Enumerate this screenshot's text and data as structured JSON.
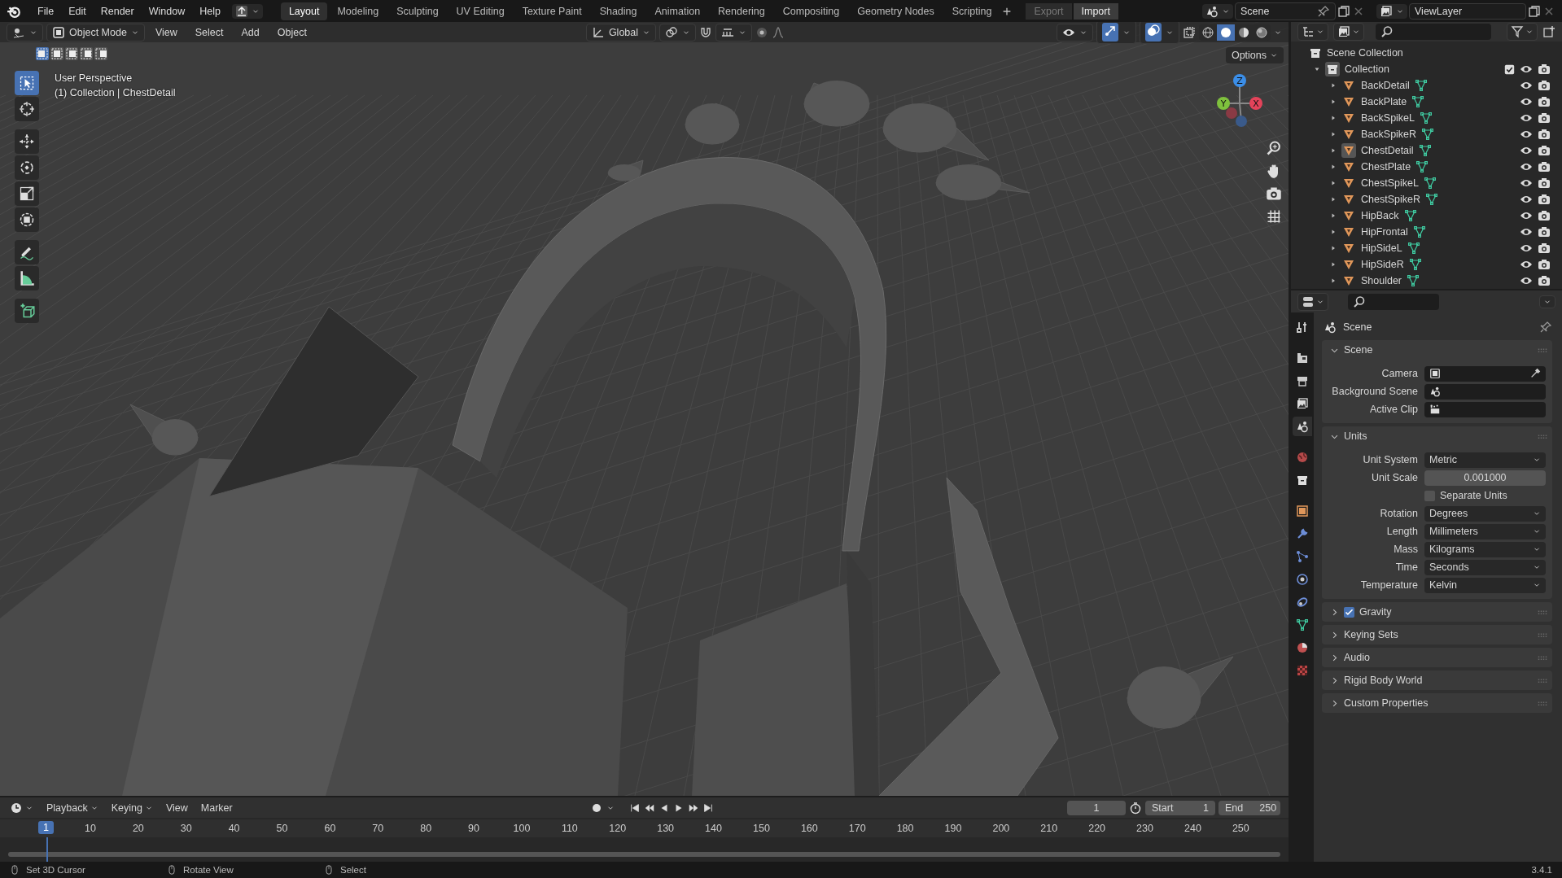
{
  "top_bar": {
    "menus": [
      "File",
      "Edit",
      "Render",
      "Window",
      "Help"
    ],
    "workspaces": [
      {
        "label": "Layout",
        "selected": true
      },
      {
        "label": "Modeling",
        "selected": false
      },
      {
        "label": "Sculpting",
        "selected": false
      },
      {
        "label": "UV Editing",
        "selected": false
      },
      {
        "label": "Texture Paint",
        "selected": false
      },
      {
        "label": "Shading",
        "selected": false
      },
      {
        "label": "Animation",
        "selected": false
      },
      {
        "label": "Rendering",
        "selected": false
      },
      {
        "label": "Compositing",
        "selected": false
      },
      {
        "label": "Geometry Nodes",
        "selected": false
      },
      {
        "label": "Scripting",
        "selected": false
      }
    ],
    "buttons": [
      {
        "label": "Export",
        "disabled": true
      },
      {
        "label": "Import",
        "disabled": false
      }
    ],
    "scene": "Scene",
    "view_layer": "ViewLayer"
  },
  "viewport": {
    "mode": "Object Mode",
    "menus": [
      "View",
      "Select",
      "Add",
      "Object"
    ],
    "orientation": "Global",
    "options": "Options",
    "select_modes": [
      {
        "selected": true
      },
      {
        "selected": false
      },
      {
        "selected": false
      },
      {
        "selected": false
      },
      {
        "selected": false
      }
    ],
    "shading": [
      {
        "kind": "wireframe",
        "selected": false
      },
      {
        "kind": "solid",
        "selected": true
      },
      {
        "kind": "material",
        "selected": false
      },
      {
        "kind": "rendered",
        "selected": false
      }
    ],
    "overlay_text": [
      "User Perspective",
      "(1) Collection | ChestDetail"
    ],
    "tools": [
      {
        "kind": "select",
        "selected": true
      },
      {
        "kind": "cursor",
        "selected": false
      },
      {
        "kind": "move",
        "selected": false
      },
      {
        "kind": "rotate",
        "selected": false
      },
      {
        "kind": "scale",
        "selected": false
      },
      {
        "kind": "transform",
        "selected": false
      },
      {
        "kind": "annotate",
        "selected": false
      },
      {
        "kind": "measure",
        "selected": false
      },
      {
        "kind": "add_cube",
        "selected": false
      }
    ],
    "gizmo_axes": [
      "Z",
      "Y",
      "X"
    ]
  },
  "outliner": {
    "root": "Scene Collection",
    "collection": {
      "name": "Collection",
      "expanded": true,
      "checked": true,
      "children": [
        {
          "name": "BackDetail",
          "selected": false,
          "expanded": false
        },
        {
          "name": "BackPlate",
          "selected": false,
          "expanded": false
        },
        {
          "name": "BackSpikeL",
          "selected": false,
          "expanded": false
        },
        {
          "name": "BackSpikeR",
          "selected": false,
          "expanded": false
        },
        {
          "name": "ChestDetail",
          "selected": true,
          "expanded": false
        },
        {
          "name": "ChestPlate",
          "selected": false,
          "expanded": false
        },
        {
          "name": "ChestSpikeL",
          "selected": false,
          "expanded": false
        },
        {
          "name": "ChestSpikeR",
          "selected": false,
          "expanded": false
        },
        {
          "name": "HipBack",
          "selected": false,
          "expanded": false
        },
        {
          "name": "HipFrontal",
          "selected": false,
          "expanded": false
        },
        {
          "name": "HipSideL",
          "selected": false,
          "expanded": false
        },
        {
          "name": "HipSideR",
          "selected": false,
          "expanded": false
        },
        {
          "name": "Shoulder",
          "selected": false,
          "expanded": false
        }
      ]
    }
  },
  "properties": {
    "context": "Scene",
    "tabs": [
      {
        "kind": "tool",
        "selected": false
      },
      {
        "kind": "render",
        "selected": false
      },
      {
        "kind": "output",
        "selected": false
      },
      {
        "kind": "view_layer",
        "selected": false
      },
      {
        "kind": "scene",
        "selected": true
      },
      {
        "kind": "world",
        "selected": false
      },
      {
        "kind": "collection",
        "selected": false
      },
      {
        "kind": "object",
        "selected": false
      },
      {
        "kind": "modifiers",
        "selected": false
      },
      {
        "kind": "particles",
        "selected": false
      },
      {
        "kind": "physics",
        "selected": false
      },
      {
        "kind": "constraints",
        "selected": false
      },
      {
        "kind": "data",
        "selected": false
      },
      {
        "kind": "material",
        "selected": false
      },
      {
        "kind": "texture",
        "selected": false
      }
    ],
    "panels": [
      {
        "title": "Scene",
        "expanded": true,
        "rows": [
          {
            "kind": "picker",
            "label": "Camera"
          },
          {
            "kind": "picker",
            "label": "Background Scene"
          },
          {
            "kind": "picker",
            "label": "Active Clip"
          }
        ]
      },
      {
        "title": "Units",
        "expanded": true,
        "rows": [
          {
            "kind": "menu",
            "label": "Unit System",
            "value": "Metric"
          },
          {
            "kind": "number",
            "label": "Unit Scale",
            "value": "0.001000"
          },
          {
            "kind": "checkbox",
            "label": "Separate Units",
            "checked": false
          },
          {
            "kind": "menu",
            "label": "Rotation",
            "value": "Degrees"
          },
          {
            "kind": "menu",
            "label": "Length",
            "value": "Millimeters"
          },
          {
            "kind": "menu",
            "label": "Mass",
            "value": "Kilograms"
          },
          {
            "kind": "menu",
            "label": "Time",
            "value": "Seconds"
          },
          {
            "kind": "menu",
            "label": "Temperature",
            "value": "Kelvin"
          }
        ]
      },
      {
        "title": "Gravity",
        "expanded": false,
        "checked": true
      },
      {
        "title": "Keying Sets",
        "expanded": false
      },
      {
        "title": "Audio",
        "expanded": false
      },
      {
        "title": "Rigid Body World",
        "expanded": false
      },
      {
        "title": "Custom Properties",
        "expanded": false
      }
    ]
  },
  "timeline": {
    "menus": [
      "Playback",
      "Keying",
      "View",
      "Marker"
    ],
    "current_frame": "1",
    "start_label": "Start",
    "start": "1",
    "end_label": "End",
    "end": "250",
    "playhead": "1",
    "ticks": [
      "10",
      "20",
      "30",
      "40",
      "50",
      "60",
      "70",
      "80",
      "90",
      "100",
      "110",
      "120",
      "130",
      "140",
      "150",
      "160",
      "170",
      "180",
      "190",
      "200",
      "210",
      "220",
      "230",
      "240",
      "250"
    ]
  },
  "status_bar": {
    "hints": [
      "Set 3D Cursor",
      "Rotate View",
      "Select"
    ],
    "version": "3.4.1"
  }
}
